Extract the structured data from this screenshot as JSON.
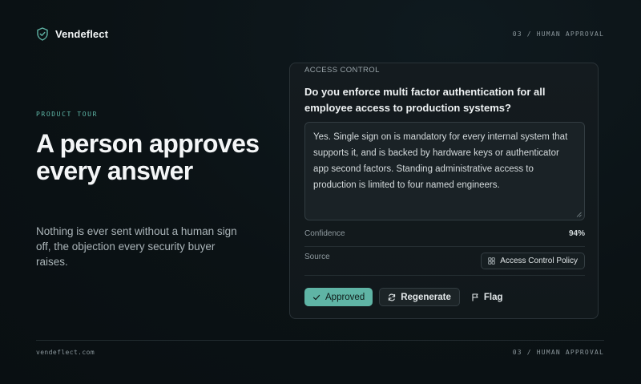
{
  "brand": {
    "name": "Vendeflect",
    "icon": "shield-check-icon",
    "accent": "#5fb4a5"
  },
  "header": {
    "step": "03 / HUMAN APPROVAL"
  },
  "intro": {
    "eyebrow": "PRODUCT TOUR",
    "headline": "A person approves every answer",
    "subtext": "Nothing is ever sent without a human sign off, the objection every security buyer raises."
  },
  "card": {
    "label": "ACCESS CONTROL",
    "question": "Do you enforce multi factor authentication for all employee access to production systems?",
    "answer": "Yes. Single sign on is mandatory for every internal system that supports it, and is backed by hardware keys or authenticator app second factors. Standing administrative access to production is limited to four named engineers.",
    "confidence_label": "Confidence",
    "confidence_value": "94%",
    "source_label": "Source",
    "source_value": "Access Control Policy",
    "actions": {
      "approved": "Approved",
      "regenerate": "Regenerate",
      "flag": "Flag"
    }
  },
  "footer": {
    "site": "vendeflect.com",
    "step": "03 / HUMAN APPROVAL"
  }
}
